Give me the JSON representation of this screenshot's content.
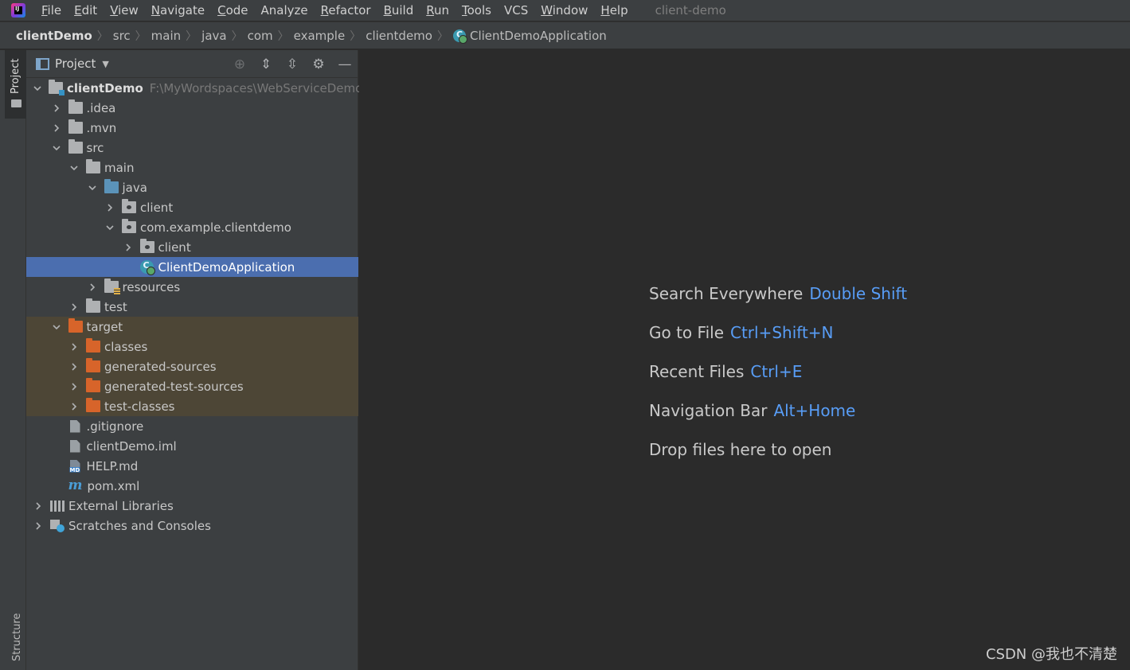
{
  "menubar": {
    "items": [
      {
        "mn": "F",
        "rest": "ile"
      },
      {
        "mn": "E",
        "rest": "dit"
      },
      {
        "mn": "V",
        "rest": "iew"
      },
      {
        "mn": "N",
        "rest": "avigate"
      },
      {
        "mn": "C",
        "rest": "ode"
      },
      {
        "mn": "",
        "rest": "Analyze"
      },
      {
        "mn": "R",
        "rest": "efactor"
      },
      {
        "mn": "B",
        "rest": "uild"
      },
      {
        "mn": "R",
        "rest": "un"
      },
      {
        "mn": "T",
        "rest": "ools"
      },
      {
        "mn": "",
        "rest": "VCS"
      },
      {
        "mn": "W",
        "rest": "indow"
      },
      {
        "mn": "H",
        "rest": "elp"
      }
    ],
    "project_title": "client-demo"
  },
  "breadcrumb": [
    "clientDemo",
    "src",
    "main",
    "java",
    "com",
    "example",
    "clientdemo",
    "ClientDemoApplication"
  ],
  "stripe": {
    "project": "Project",
    "structure": "Structure"
  },
  "project_panel": {
    "title": "Project",
    "tree": [
      {
        "label": "clientDemo",
        "path": "F:\\MyWordspaces\\WebServiceDemo",
        "depth": 0,
        "arrow": "down",
        "icon": "module-folder"
      },
      {
        "label": ".idea",
        "depth": 1,
        "arrow": "right",
        "icon": "folder"
      },
      {
        "label": ".mvn",
        "depth": 1,
        "arrow": "right",
        "icon": "folder"
      },
      {
        "label": "src",
        "depth": 1,
        "arrow": "down",
        "icon": "folder"
      },
      {
        "label": "main",
        "depth": 2,
        "arrow": "down",
        "icon": "folder"
      },
      {
        "label": "java",
        "depth": 3,
        "arrow": "down",
        "icon": "source-folder"
      },
      {
        "label": "client",
        "depth": 4,
        "arrow": "right",
        "icon": "package"
      },
      {
        "label": "com.example.clientdemo",
        "depth": 4,
        "arrow": "down",
        "icon": "package"
      },
      {
        "label": "client",
        "depth": 5,
        "arrow": "right",
        "icon": "package"
      },
      {
        "label": "ClientDemoApplication",
        "depth": 5,
        "arrow": "none",
        "icon": "spring-class",
        "selected": true
      },
      {
        "label": "resources",
        "depth": 3,
        "arrow": "right",
        "icon": "resources-folder"
      },
      {
        "label": "test",
        "depth": 2,
        "arrow": "right",
        "icon": "folder"
      },
      {
        "label": "target",
        "depth": 1,
        "arrow": "down",
        "icon": "excluded-folder"
      },
      {
        "label": "classes",
        "depth": 2,
        "arrow": "right",
        "icon": "excluded-folder"
      },
      {
        "label": "generated-sources",
        "depth": 2,
        "arrow": "right",
        "icon": "excluded-folder"
      },
      {
        "label": "generated-test-sources",
        "depth": 2,
        "arrow": "right",
        "icon": "excluded-folder"
      },
      {
        "label": "test-classes",
        "depth": 2,
        "arrow": "right",
        "icon": "excluded-folder"
      },
      {
        "label": ".gitignore",
        "depth": 1,
        "arrow": "none",
        "icon": "gitignore-file"
      },
      {
        "label": "clientDemo.iml",
        "depth": 1,
        "arrow": "none",
        "icon": "iml-file"
      },
      {
        "label": "HELP.md",
        "depth": 1,
        "arrow": "none",
        "icon": "markdown-file"
      },
      {
        "label": "pom.xml",
        "depth": 1,
        "arrow": "none",
        "icon": "maven-file"
      },
      {
        "label": "External Libraries",
        "depth": 0,
        "arrow": "right",
        "icon": "libraries"
      },
      {
        "label": "Scratches and Consoles",
        "depth": 0,
        "arrow": "right",
        "icon": "scratches"
      }
    ]
  },
  "editor": {
    "hints": [
      {
        "text": "Search Everywhere",
        "key": "Double Shift"
      },
      {
        "text": "Go to File",
        "key": "Ctrl+Shift+N"
      },
      {
        "text": "Recent Files",
        "key": "Ctrl+E"
      },
      {
        "text": "Navigation Bar",
        "key": "Alt+Home"
      },
      {
        "text": "Drop files here to open",
        "key": ""
      }
    ]
  },
  "watermark": "CSDN @我也不清楚",
  "colors": {
    "accent": "#589df6",
    "selection": "#4b6eaf",
    "excluded": "#d7642a",
    "panel": "#3c3f41",
    "editor": "#2b2b2b"
  }
}
